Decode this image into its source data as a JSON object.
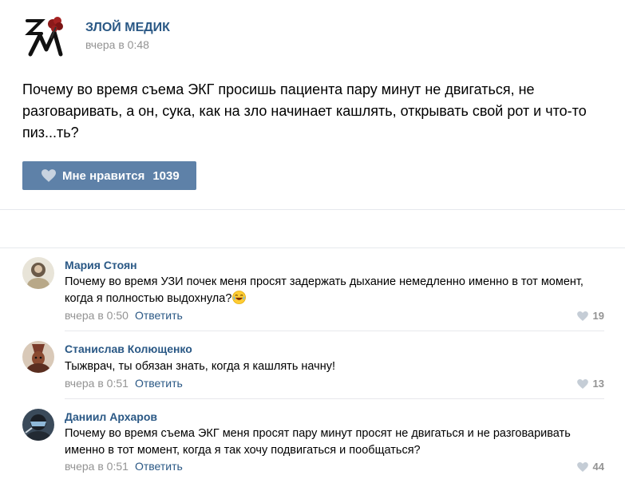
{
  "post": {
    "author": "ЗЛОЙ МЕДИК",
    "time": "вчера в 0:48",
    "text": "Почему во время съема ЭКГ просишь пациента пару минут не двигаться, не разговаривать, а он, сука, как на зло начинает кашлять, открывать свой рот и что-то пиз...ть?",
    "like_label": "Мне нравится",
    "like_count": "1039",
    "logo_text": "ЗМ"
  },
  "comments": [
    {
      "author": "Мария Стоян",
      "text": "Почему во время УЗИ почек меня просят задержать дыхание немедленно именно в тот момент, когда я полностью выдохнула?",
      "time": "вчера в 0:50",
      "reply": "Ответить",
      "likes": "19"
    },
    {
      "author": "Станислав Колющенко",
      "text": "Тыжврач, ты обязан знать, когда я кашлять начну!",
      "time": "вчера в 0:51",
      "reply": "Ответить",
      "likes": "13"
    },
    {
      "author": "Даниил Архаров",
      "text": "Почему во время съема ЭКГ меня просят пару минут просят не двигаться и не разговаривать именно в тот момент, когда я так хочу подвигаться и пообщаться?",
      "time": "вчера в 0:51",
      "reply": "Ответить",
      "likes": "44"
    }
  ],
  "colors": {
    "link": "#2a5885",
    "muted": "#939393",
    "like_button": "#5e81a8"
  }
}
